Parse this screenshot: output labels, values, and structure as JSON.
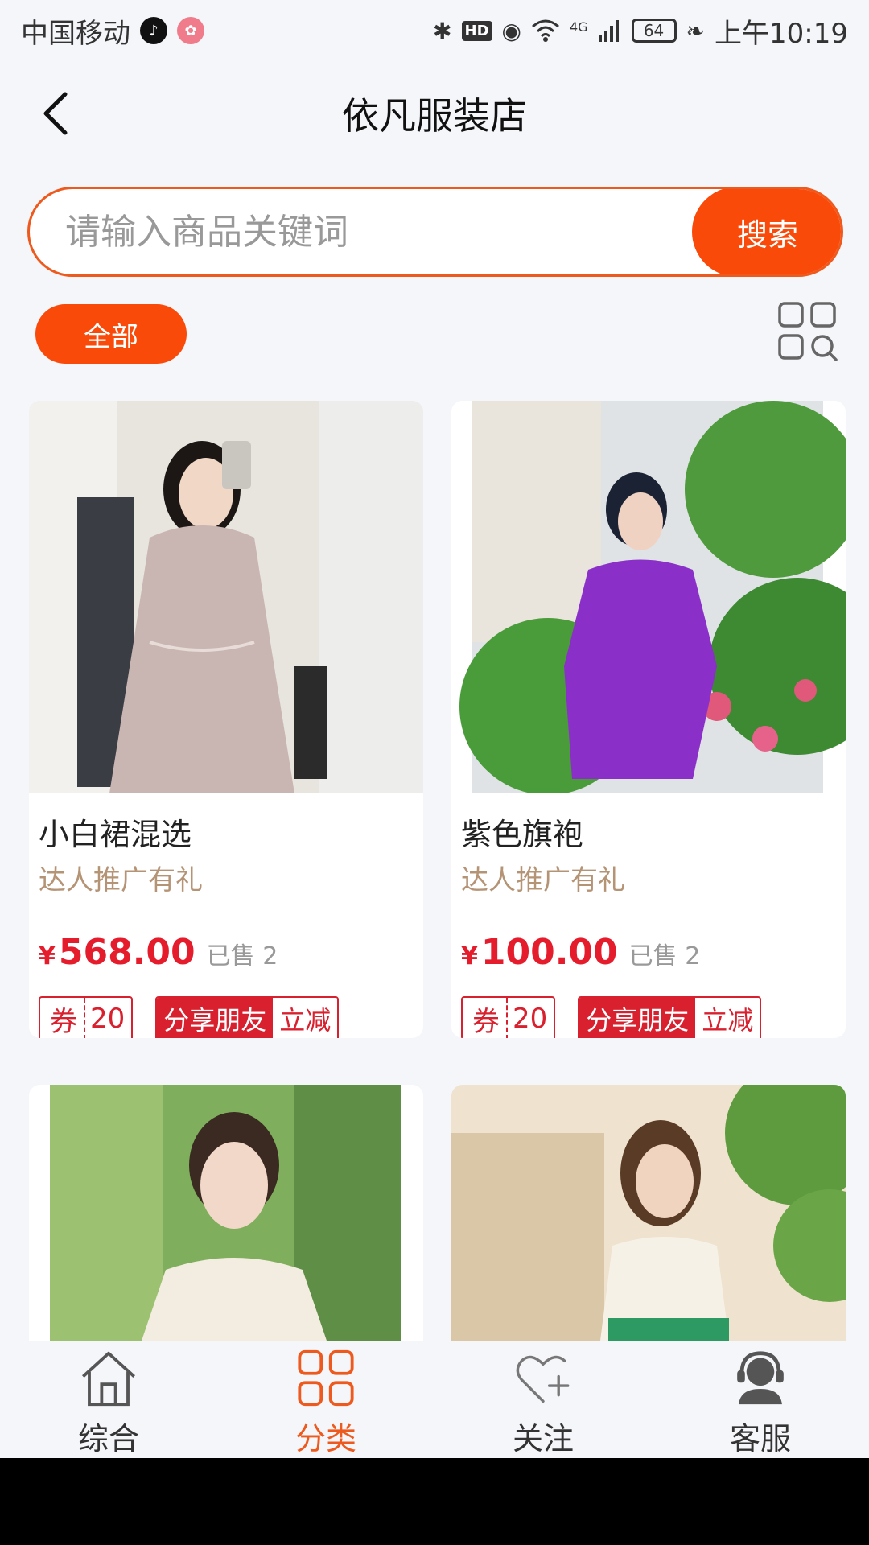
{
  "status_bar": {
    "carrier": "中国移动",
    "battery": "64",
    "time": "上午10:19",
    "network": "4G",
    "icons": [
      "tiktok-icon",
      "app-icon",
      "bluetooth-icon",
      "hd-icon",
      "eye-icon",
      "wifi-icon",
      "signal-icon",
      "battery-icon",
      "leaf-icon"
    ]
  },
  "header": {
    "title": "依凡服装店",
    "back_icon": "chevron-left-icon"
  },
  "search": {
    "placeholder": "请输入商品关键词",
    "value": "",
    "button_label": "搜索"
  },
  "filter": {
    "all_label": "全部",
    "layout_icon": "grid-layout-icon"
  },
  "colors": {
    "accent": "#fa4a0a",
    "price": "#e51c2c",
    "promo": "#b59476"
  },
  "products": [
    {
      "name": "小白裙混选",
      "promo": "达人推广有礼",
      "currency": "¥",
      "price": "568.00",
      "sold": "已售 2",
      "coupon_label": "券",
      "coupon_value": "20",
      "share_label": "分享朋友",
      "share_action": "立减"
    },
    {
      "name": "紫色旗袍",
      "promo": "达人推广有礼",
      "currency": "¥",
      "price": "100.00",
      "sold": "已售 2",
      "coupon_label": "券",
      "coupon_value": "20",
      "share_label": "分享朋友",
      "share_action": "立减"
    },
    {
      "name": "",
      "promo": ""
    },
    {
      "name": "",
      "promo": ""
    }
  ],
  "tabs": [
    {
      "label": "综合",
      "icon": "home-icon"
    },
    {
      "label": "分类",
      "icon": "category-grid-icon",
      "active": true
    },
    {
      "label": "关注",
      "icon": "heart-plus-icon"
    },
    {
      "label": "客服",
      "icon": "customer-service-icon"
    }
  ]
}
